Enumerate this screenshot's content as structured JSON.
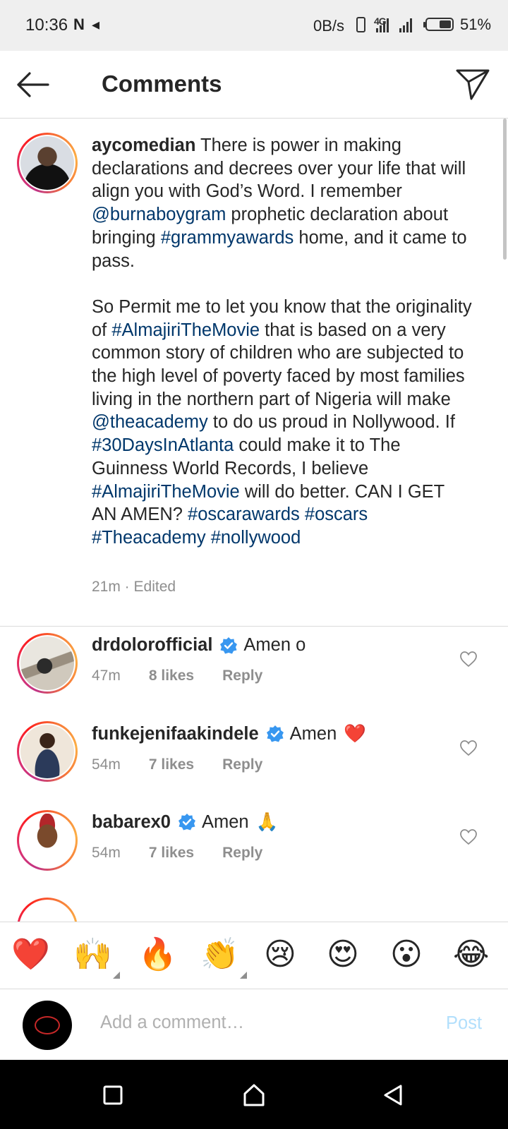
{
  "status_bar": {
    "time": "10:36",
    "left_icons": "N ◂",
    "net_speed": "0B/s",
    "signal_label": "4G",
    "battery": "51%",
    "battery_level": 0.51
  },
  "header": {
    "title": "Comments",
    "back_icon": "arrow-left-icon",
    "send_icon": "paper-plane-icon"
  },
  "caption": {
    "username": "aycomedian",
    "segments": [
      {
        "t": " There is power in making declarations and decrees over your life that will align you with God’s Word. I remember "
      },
      {
        "t": "@burnaboygram",
        "tag": true
      },
      {
        "t": " prophetic declaration about bringing "
      },
      {
        "t": "#grammyawards",
        "tag": true
      },
      {
        "t": " home, and it came to pass.\n\nSo Permit me to let you know that the originality of "
      },
      {
        "t": "#AlmajiriTheMovie",
        "tag": true
      },
      {
        "t": " that is based on a very common story of children who are subjected to the high level of poverty faced by most families living in the northern part of Nigeria will make "
      },
      {
        "t": "@theacademy",
        "tag": true
      },
      {
        "t": " to do us proud in Nollywood. If "
      },
      {
        "t": "#30DaysInAtlanta",
        "tag": true
      },
      {
        "t": " could make it to The Guinness World Records, I believe "
      },
      {
        "t": "#AlmajiriTheMovie",
        "tag": true
      },
      {
        "t": " will do better. CAN I GET AN AMEN? "
      },
      {
        "t": "#oscarawards",
        "tag": true
      },
      {
        "t": " "
      },
      {
        "t": "#oscars",
        "tag": true
      },
      {
        "t": " "
      },
      {
        "t": "#Theacademy",
        "tag": true
      },
      {
        "t": " "
      },
      {
        "t": "#nollywood",
        "tag": true
      }
    ],
    "meta": "21m · Edited"
  },
  "comments": [
    {
      "username": "drdolorofficial",
      "text": "Amen o",
      "emoji": "",
      "time": "47m",
      "likes": "8 likes",
      "reply": "Reply"
    },
    {
      "username": "funkejenifaakindele",
      "text": "Amen",
      "emoji": "❤️",
      "time": "54m",
      "likes": "7 likes",
      "reply": "Reply"
    },
    {
      "username": "babarex0",
      "text": "Amen",
      "emoji": "🙏",
      "time": "54m",
      "likes": "7 likes",
      "reply": "Reply"
    }
  ],
  "reactions": [
    "❤️",
    "🙌",
    "🔥",
    "👏",
    "😢",
    "😍",
    "😮",
    "😂"
  ],
  "composer": {
    "placeholder": "Add a comment…",
    "post_label": "Post"
  },
  "accent": {
    "link_color": "#00376b",
    "verified_color": "#3897f0",
    "post_disabled_color": "#b2dffc"
  }
}
